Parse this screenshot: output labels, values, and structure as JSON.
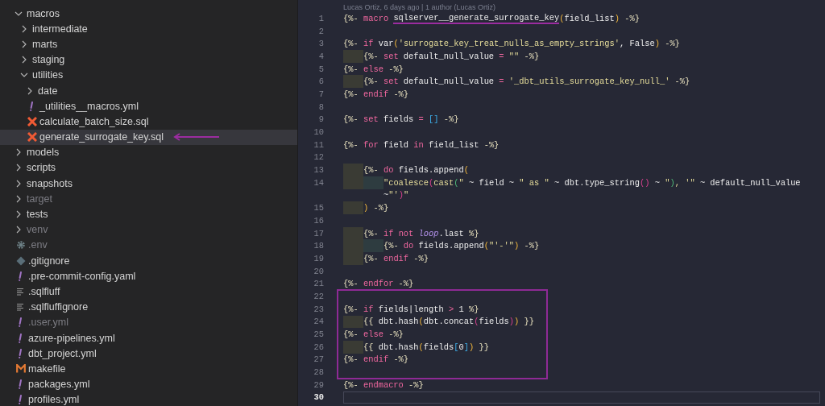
{
  "explorer": {
    "items": [
      {
        "label": "macros",
        "kind": "folder",
        "expanded": true,
        "selected": false,
        "ignored": false,
        "arrow": false,
        "children": [
          {
            "label": "intermediate",
            "kind": "folder",
            "expanded": false,
            "selected": false,
            "ignored": false,
            "arrow": false
          },
          {
            "label": "marts",
            "kind": "folder",
            "expanded": false,
            "selected": false,
            "ignored": false,
            "arrow": false
          },
          {
            "label": "staging",
            "kind": "folder",
            "expanded": false,
            "selected": false,
            "ignored": false,
            "arrow": false
          },
          {
            "label": "utilities",
            "kind": "folder",
            "expanded": true,
            "selected": false,
            "ignored": false,
            "arrow": false,
            "children": [
              {
                "label": "date",
                "kind": "folder",
                "expanded": false,
                "selected": false,
                "ignored": false,
                "arrow": false
              },
              {
                "label": "_utilities__macros.yml",
                "kind": "yaml",
                "selected": false,
                "ignored": false,
                "arrow": false
              },
              {
                "label": "calculate_batch_size.sql",
                "kind": "sql",
                "selected": false,
                "ignored": false,
                "arrow": false
              },
              {
                "label": "generate_surrogate_key.sql",
                "kind": "sql",
                "selected": true,
                "ignored": false,
                "arrow": true
              }
            ]
          }
        ]
      },
      {
        "label": "models",
        "kind": "folder",
        "expanded": false,
        "selected": false,
        "ignored": false,
        "arrow": false
      },
      {
        "label": "scripts",
        "kind": "folder",
        "expanded": false,
        "selected": false,
        "ignored": false,
        "arrow": false
      },
      {
        "label": "snapshots",
        "kind": "folder",
        "expanded": false,
        "selected": false,
        "ignored": false,
        "arrow": false
      },
      {
        "label": "target",
        "kind": "folder",
        "expanded": false,
        "selected": false,
        "ignored": true,
        "arrow": false
      },
      {
        "label": "tests",
        "kind": "folder",
        "expanded": false,
        "selected": false,
        "ignored": false,
        "arrow": false
      },
      {
        "label": "venv",
        "kind": "folder",
        "expanded": false,
        "selected": false,
        "ignored": true,
        "arrow": false
      },
      {
        "label": ".env",
        "kind": "config",
        "selected": false,
        "ignored": true,
        "arrow": false
      },
      {
        "label": ".gitignore",
        "kind": "git",
        "selected": false,
        "ignored": false,
        "arrow": false
      },
      {
        "label": ".pre-commit-config.yaml",
        "kind": "yaml",
        "selected": false,
        "ignored": false,
        "arrow": false
      },
      {
        "label": ".sqlfluff",
        "kind": "text",
        "selected": false,
        "ignored": false,
        "arrow": false
      },
      {
        "label": ".sqlfluffignore",
        "kind": "text",
        "selected": false,
        "ignored": false,
        "arrow": false
      },
      {
        "label": ".user.yml",
        "kind": "yaml",
        "selected": false,
        "ignored": true,
        "arrow": false
      },
      {
        "label": "azure-pipelines.yml",
        "kind": "yaml",
        "selected": false,
        "ignored": false,
        "arrow": false
      },
      {
        "label": "dbt_project.yml",
        "kind": "yaml",
        "selected": false,
        "ignored": false,
        "arrow": false
      },
      {
        "label": "makefile",
        "kind": "make",
        "selected": false,
        "ignored": false,
        "arrow": false
      },
      {
        "label": "packages.yml",
        "kind": "yaml",
        "selected": false,
        "ignored": false,
        "arrow": false
      },
      {
        "label": "profiles.yml",
        "kind": "yaml",
        "selected": false,
        "ignored": false,
        "arrow": false
      }
    ]
  },
  "editor": {
    "blame": "Lucas Ortiz, 6 days ago | 1 author (Lucas Ortiz)",
    "lines": [
      {
        "n": "1",
        "kind": "flat",
        "boxed": false,
        "current": false,
        "tokens": [
          {
            "text": "{%- ",
            "kind": "tag"
          },
          {
            "text": "macro ",
            "kind": "keyword"
          },
          {
            "text": "sqlserver__generate_surrogate_key",
            "kind": "underlined"
          },
          {
            "text": "(",
            "kind": "paren1"
          },
          {
            "text": "field_list",
            "kind": "plain"
          },
          {
            "text": ")",
            "kind": "paren1"
          },
          {
            "text": " -%}",
            "kind": "tag"
          }
        ]
      },
      {
        "n": "2",
        "kind": "flat",
        "boxed": false,
        "current": false
      },
      {
        "n": "3",
        "kind": "flat",
        "boxed": false,
        "current": false,
        "tokens": [
          {
            "text": "{%- ",
            "kind": "tag"
          },
          {
            "text": "if",
            "kind": "keyword"
          },
          {
            "text": " var",
            "kind": "plain"
          },
          {
            "text": "(",
            "kind": "paren1"
          },
          {
            "text": "'surrogate_key_treat_nulls_as_empty_strings'",
            "kind": "string"
          },
          {
            "text": ", False",
            "kind": "plain"
          },
          {
            "text": ")",
            "kind": "paren1"
          },
          {
            "text": " -%}",
            "kind": "tag"
          }
        ]
      },
      {
        "n": "4",
        "kind": "indented",
        "boxed": false,
        "current": false,
        "tokens": [
          {
            "text": "{%- ",
            "kind": "tag"
          },
          {
            "text": "set",
            "kind": "keyword"
          },
          {
            "text": " default_null_value ",
            "kind": "plain"
          },
          {
            "text": "= ",
            "kind": "keyword"
          },
          {
            "text": "\"\"",
            "kind": "string"
          },
          {
            "text": " -%}",
            "kind": "tag"
          }
        ]
      },
      {
        "n": "5",
        "kind": "flat",
        "boxed": false,
        "current": false,
        "tokens": [
          {
            "text": "{%- ",
            "kind": "tag"
          },
          {
            "text": "else",
            "kind": "keyword"
          },
          {
            "text": " -%}",
            "kind": "tag"
          }
        ]
      },
      {
        "n": "6",
        "kind": "indented",
        "boxed": false,
        "current": false,
        "tokens": [
          {
            "text": "{%- ",
            "kind": "tag"
          },
          {
            "text": "set",
            "kind": "keyword"
          },
          {
            "text": " default_null_value ",
            "kind": "plain"
          },
          {
            "text": "= ",
            "kind": "keyword"
          },
          {
            "text": "'_dbt_utils_surrogate_key_null_'",
            "kind": "string"
          },
          {
            "text": " -%}",
            "kind": "tag"
          }
        ]
      },
      {
        "n": "7",
        "kind": "flat",
        "boxed": false,
        "current": false,
        "tokens": [
          {
            "text": "{%- ",
            "kind": "tag"
          },
          {
            "text": "endif",
            "kind": "keyword"
          },
          {
            "text": " -%}",
            "kind": "tag"
          }
        ]
      },
      {
        "n": "8",
        "kind": "flat",
        "boxed": false,
        "current": false
      },
      {
        "n": "9",
        "kind": "flat",
        "boxed": false,
        "current": false,
        "tokens": [
          {
            "text": "{%- ",
            "kind": "tag"
          },
          {
            "text": "set",
            "kind": "keyword"
          },
          {
            "text": " fields ",
            "kind": "plain"
          },
          {
            "text": "= ",
            "kind": "keyword"
          },
          {
            "text": "[]",
            "kind": "paren3"
          },
          {
            "text": " -%}",
            "kind": "tag"
          }
        ]
      },
      {
        "n": "10",
        "kind": "flat",
        "boxed": false,
        "current": false
      },
      {
        "n": "11",
        "kind": "flat",
        "boxed": false,
        "current": false,
        "tokens": [
          {
            "text": "{%- ",
            "kind": "tag"
          },
          {
            "text": "for",
            "kind": "keyword"
          },
          {
            "text": " field ",
            "kind": "plain"
          },
          {
            "text": "in",
            "kind": "keyword"
          },
          {
            "text": " field_list ",
            "kind": "plain"
          },
          {
            "text": "-%}",
            "kind": "tag"
          }
        ]
      },
      {
        "n": "12",
        "kind": "flat",
        "boxed": false,
        "current": false
      },
      {
        "n": "13",
        "kind": "indented",
        "boxed": false,
        "current": false,
        "tokens": [
          {
            "text": "{%- ",
            "kind": "tag"
          },
          {
            "text": "do",
            "kind": "keyword"
          },
          {
            "text": " fields.append",
            "kind": "plain"
          },
          {
            "text": "(",
            "kind": "paren1"
          }
        ]
      },
      {
        "n": "14",
        "kind": "double_indented",
        "boxed": false,
        "current": false,
        "tokens": [
          {
            "text": "\"coalesce",
            "kind": "string"
          },
          {
            "text": "(",
            "kind": "paren2"
          },
          {
            "text": "cast",
            "kind": "string"
          },
          {
            "text": "(",
            "kind": "paren4"
          },
          {
            "text": "\"",
            "kind": "string"
          },
          {
            "text": " ~ field ~ ",
            "kind": "plain"
          },
          {
            "text": "\" as \"",
            "kind": "string"
          },
          {
            "text": " ~ dbt.type_string",
            "kind": "plain"
          },
          {
            "text": "()",
            "kind": "paren2"
          },
          {
            "text": " ~ ",
            "kind": "plain"
          },
          {
            "text": "\"",
            "kind": "string"
          },
          {
            "text": ")",
            "kind": "paren4"
          },
          {
            "text": ", '\"",
            "kind": "string"
          },
          {
            "text": " ~ default_null_value",
            "kind": "plain"
          }
        ],
        "continuation": [
          {
            "text": "~",
            "kind": "plain"
          },
          {
            "text": "\"'",
            "kind": "string"
          },
          {
            "text": ")",
            "kind": "paren2"
          },
          {
            "text": "\"",
            "kind": "string"
          }
        ]
      },
      {
        "n": "15",
        "kind": "indented",
        "boxed": false,
        "current": false,
        "tokens": [
          {
            "text": ")",
            "kind": "paren1"
          },
          {
            "text": " -%}",
            "kind": "tag"
          }
        ]
      },
      {
        "n": "16",
        "kind": "flat",
        "boxed": false,
        "current": false
      },
      {
        "n": "17",
        "kind": "indented",
        "boxed": false,
        "current": false,
        "tokens": [
          {
            "text": "{%- ",
            "kind": "tag"
          },
          {
            "text": "if ",
            "kind": "keyword"
          },
          {
            "text": "not ",
            "kind": "keyword"
          },
          {
            "text": "loop",
            "kind": "variable"
          },
          {
            "text": ".last ",
            "kind": "plain"
          },
          {
            "text": "%}",
            "kind": "tag"
          }
        ]
      },
      {
        "n": "18",
        "kind": "double_indented",
        "boxed": false,
        "current": false,
        "tokens": [
          {
            "text": "{%- ",
            "kind": "tag"
          },
          {
            "text": "do",
            "kind": "keyword"
          },
          {
            "text": " fields.append",
            "kind": "plain"
          },
          {
            "text": "(",
            "kind": "paren1"
          },
          {
            "text": "\"'-'\"",
            "kind": "string"
          },
          {
            "text": ")",
            "kind": "paren1"
          },
          {
            "text": " -%}",
            "kind": "tag"
          }
        ]
      },
      {
        "n": "19",
        "kind": "indented",
        "boxed": false,
        "current": false,
        "tokens": [
          {
            "text": "{%- ",
            "kind": "tag"
          },
          {
            "text": "endif",
            "kind": "keyword"
          },
          {
            "text": " -%}",
            "kind": "tag"
          }
        ]
      },
      {
        "n": "20",
        "kind": "flat",
        "boxed": false,
        "current": false
      },
      {
        "n": "21",
        "kind": "flat",
        "boxed": false,
        "current": false,
        "tokens": [
          {
            "text": "{%- ",
            "kind": "tag"
          },
          {
            "text": "endfor",
            "kind": "keyword"
          },
          {
            "text": " -%}",
            "kind": "tag"
          }
        ]
      },
      {
        "n": "22",
        "kind": "flat",
        "boxed": true,
        "current": false
      },
      {
        "n": "23",
        "kind": "flat",
        "boxed": true,
        "current": false,
        "tokens": [
          {
            "text": "{%- ",
            "kind": "tag"
          },
          {
            "text": "if",
            "kind": "keyword"
          },
          {
            "text": " fields|length ",
            "kind": "plain"
          },
          {
            "text": "> ",
            "kind": "keyword"
          },
          {
            "text": "1 ",
            "kind": "plain"
          },
          {
            "text": "%}",
            "kind": "tag"
          }
        ]
      },
      {
        "n": "24",
        "kind": "indented",
        "boxed": true,
        "current": false,
        "tokens": [
          {
            "text": "{{ ",
            "kind": "tag"
          },
          {
            "text": "dbt.hash",
            "kind": "plain"
          },
          {
            "text": "(",
            "kind": "paren1"
          },
          {
            "text": "dbt.concat",
            "kind": "plain"
          },
          {
            "text": "(",
            "kind": "paren2"
          },
          {
            "text": "fields",
            "kind": "plain"
          },
          {
            "text": ")",
            "kind": "paren2"
          },
          {
            "text": ")",
            "kind": "paren1"
          },
          {
            "text": " }}",
            "kind": "tag"
          }
        ]
      },
      {
        "n": "25",
        "kind": "flat",
        "boxed": true,
        "current": false,
        "tokens": [
          {
            "text": "{%- ",
            "kind": "tag"
          },
          {
            "text": "else",
            "kind": "keyword"
          },
          {
            "text": " -%}",
            "kind": "tag"
          }
        ]
      },
      {
        "n": "26",
        "kind": "indented",
        "boxed": true,
        "current": false,
        "tokens": [
          {
            "text": "{{ ",
            "kind": "tag"
          },
          {
            "text": "dbt.hash",
            "kind": "plain"
          },
          {
            "text": "(",
            "kind": "paren1"
          },
          {
            "text": "fields",
            "kind": "plain"
          },
          {
            "text": "[",
            "kind": "paren3"
          },
          {
            "text": "0",
            "kind": "plain"
          },
          {
            "text": "]",
            "kind": "paren3"
          },
          {
            "text": ")",
            "kind": "paren1"
          },
          {
            "text": " }}",
            "kind": "tag"
          }
        ]
      },
      {
        "n": "27",
        "kind": "flat",
        "boxed": true,
        "current": false,
        "tokens": [
          {
            "text": "{%- ",
            "kind": "tag"
          },
          {
            "text": "endif",
            "kind": "keyword"
          },
          {
            "text": " -%}",
            "kind": "tag"
          }
        ]
      },
      {
        "n": "28",
        "kind": "flat",
        "boxed": true,
        "current": false
      },
      {
        "n": "29",
        "kind": "flat",
        "boxed": false,
        "current": false,
        "tokens": [
          {
            "text": "{%- ",
            "kind": "tag"
          },
          {
            "text": "endmacro",
            "kind": "keyword"
          },
          {
            "text": " -%}",
            "kind": "tag"
          }
        ]
      },
      {
        "n": "30",
        "kind": "flat",
        "boxed": false,
        "current": true
      }
    ]
  }
}
